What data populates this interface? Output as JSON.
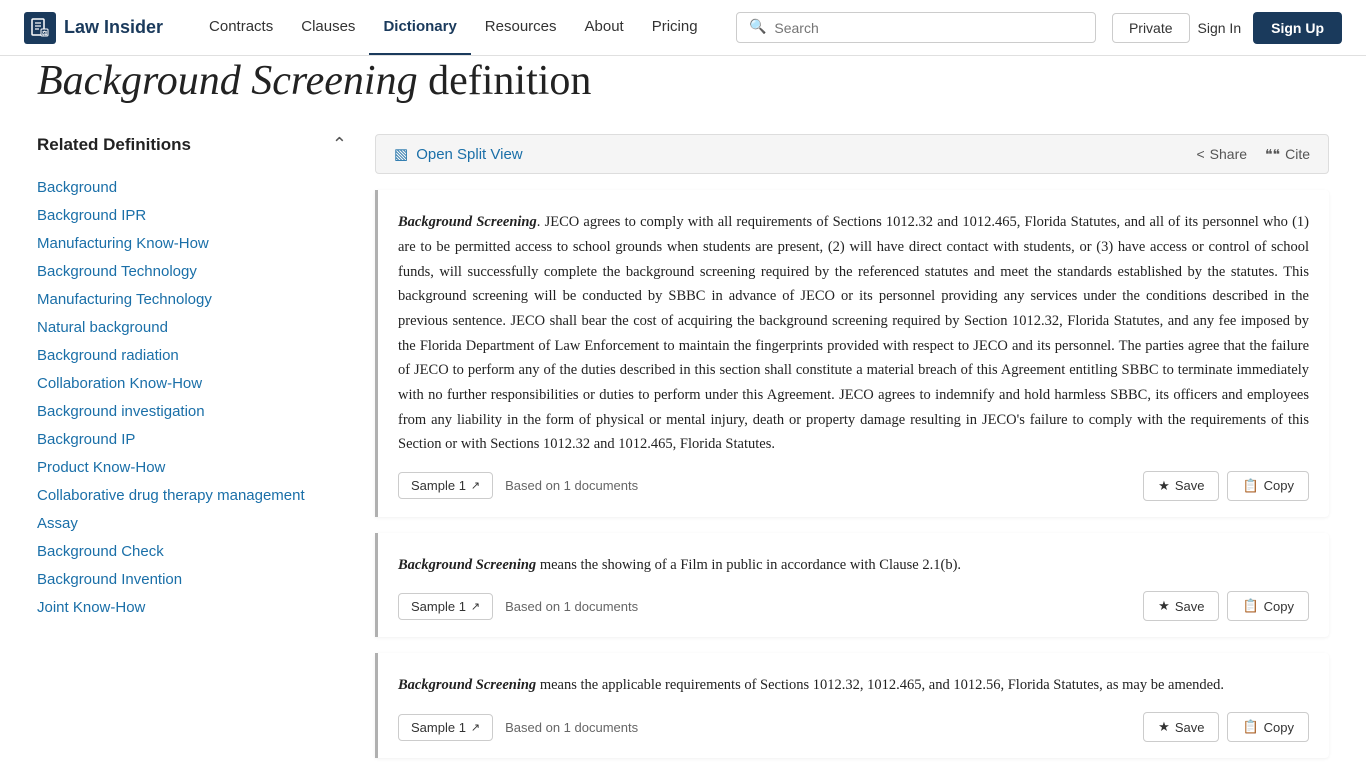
{
  "header": {
    "logo_text": "Law Insider",
    "logo_icon": "📄",
    "nav_items": [
      {
        "label": "Contracts",
        "active": false
      },
      {
        "label": "Clauses",
        "active": false
      },
      {
        "label": "Dictionary",
        "active": true
      },
      {
        "label": "Resources",
        "active": false
      },
      {
        "label": "About",
        "active": false
      },
      {
        "label": "Pricing",
        "active": false
      }
    ],
    "search_placeholder": "Search",
    "btn_private": "Private",
    "btn_signin": "Sign In",
    "btn_signup": "Sign Up"
  },
  "page": {
    "title_italic": "Background Screening",
    "title_normal": " definition"
  },
  "sidebar": {
    "title": "Related Definitions",
    "items": [
      "Background",
      "Background IPR",
      "Manufacturing Know-How",
      "Background Technology",
      "Manufacturing Technology",
      "Natural background",
      "Background radiation",
      "Collaboration Know-How",
      "Background investigation",
      "Background IP",
      "Product Know-How",
      "Collaborative drug therapy management",
      "Assay",
      "Background Check",
      "Background Invention",
      "Joint Know-How"
    ]
  },
  "split_view": {
    "label": "Open Split View",
    "share_label": "Share",
    "cite_label": "Cite"
  },
  "definitions": [
    {
      "term": "Background Screening",
      "text": ". JECO agrees to comply with all requirements of Sections 1012.32 and 1012.465, Florida Statutes, and all of its personnel who (1) are to be permitted access to school grounds when students are present, (2) will have direct contact with students, or (3) have access or control of school funds, will successfully complete the background screening required by the referenced statutes and meet the standards established by the statutes. This background screening will be conducted by SBBC in advance of JECO or its personnel providing any services under the conditions described in the previous sentence. JECO shall bear the cost of acquiring the background screening required by Section 1012.32, Florida Statutes, and any fee imposed by the Florida Department of Law Enforcement to maintain the fingerprints provided with respect to JECO and its personnel. The parties agree that the failure of JECO to perform any of the duties described in this section shall constitute a material breach of this Agreement entitling SBBC to terminate immediately with no further responsibilities or duties to perform under this Agreement. JECO agrees to indemnify and hold harmless SBBC, its officers and employees from any liability in the form of physical or mental injury, death or property damage resulting in JECO's failure to comply with the requirements of this Section or with Sections 1012.32 and 1012.465, Florida Statutes.",
      "sample": "Sample 1",
      "based_on": "Based on 1 documents",
      "save_label": "Save",
      "copy_label": "Copy"
    },
    {
      "term": "Background Screening",
      "text": " means the showing of a Film in public in accordance with Clause 2.1(b).",
      "sample": "Sample 1",
      "based_on": "Based on 1 documents",
      "save_label": "Save",
      "copy_label": "Copy"
    },
    {
      "term": "Background Screening",
      "text": " means the applicable requirements of Sections 1012.32, 1012.465, and 1012.56, Florida Statutes, as may be amended.",
      "sample": "Sample 1",
      "based_on": "Based on 1 documents",
      "save_label": "Save",
      "copy_label": "Copy"
    }
  ]
}
